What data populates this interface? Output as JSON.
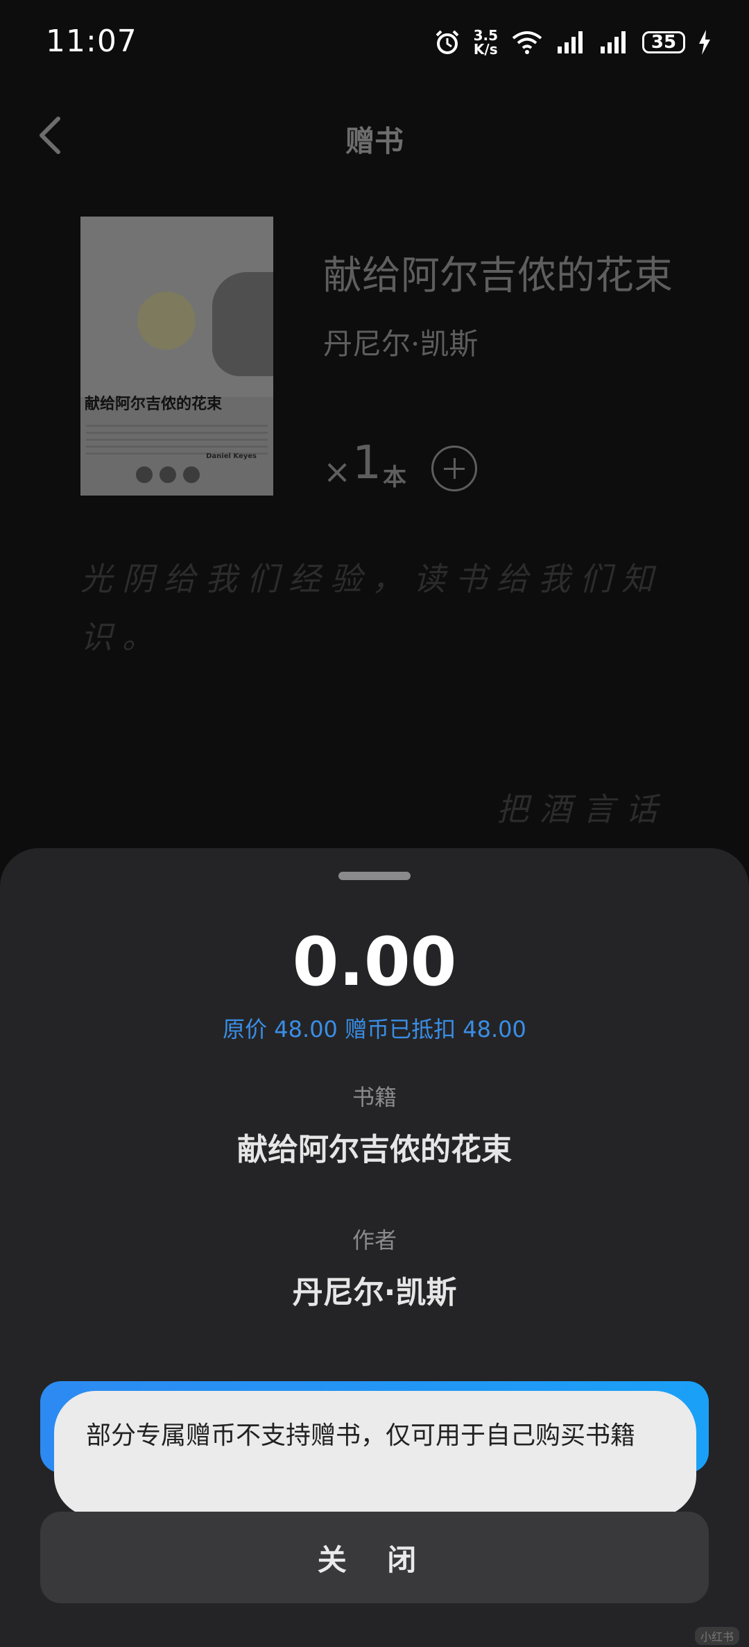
{
  "status_bar": {
    "time": "11:07",
    "net_speed_value": "3.5",
    "net_speed_unit": "K/s",
    "battery": "35"
  },
  "header": {
    "title": "赠书"
  },
  "book": {
    "title": "献给阿尔吉侬的花束",
    "author": "丹尼尔·凯斯",
    "quantity_prefix": "×",
    "quantity": "1",
    "quantity_unit": "本",
    "cover": {
      "title_text": "献给阿尔吉侬的花束",
      "author_text": "Daniel Keyes"
    }
  },
  "message": {
    "text": "光阴给我们经验，读书给我们知识。",
    "signature": "把酒言话"
  },
  "sheet": {
    "price": "0.00",
    "price_note": "原价 48.00 赠币已抵扣 48.00",
    "book_label": "书籍",
    "book_value": "献给阿尔吉侬的花束",
    "author_label": "作者",
    "author_value": "丹尼尔·凯斯",
    "toast": "部分专属赠币不支持赠书，仅可用于自己购买书籍",
    "close_label": "关 闭"
  },
  "watermark": "小红书",
  "colors": {
    "accent": "#2d8af2",
    "sheet_bg": "#242426",
    "toast_bg": "#ebebeb"
  }
}
